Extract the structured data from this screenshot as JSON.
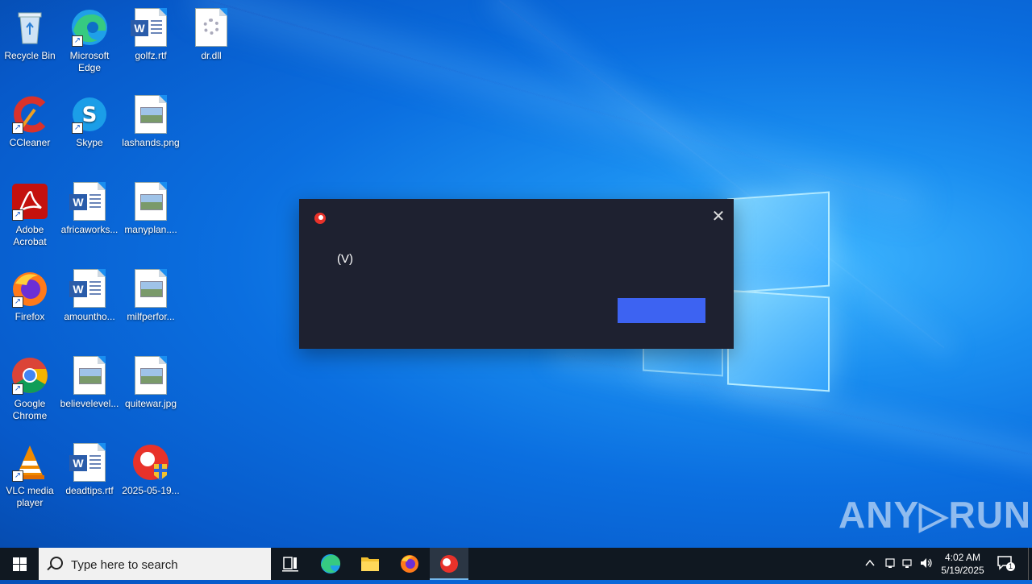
{
  "desktop": {
    "icons": [
      {
        "label": "Recycle Bin"
      },
      {
        "label": "Microsoft Edge"
      },
      {
        "label": "golfz.rtf"
      },
      {
        "label": "dr.dll"
      },
      {
        "label": "CCleaner"
      },
      {
        "label": "Skype"
      },
      {
        "label": "lashands.png"
      },
      {
        "label": "Adobe Acrobat"
      },
      {
        "label": "africaworks..."
      },
      {
        "label": "manyplan...."
      },
      {
        "label": "Firefox"
      },
      {
        "label": "amountho..."
      },
      {
        "label": "milfperfor..."
      },
      {
        "label": "Google Chrome"
      },
      {
        "label": "believelevel..."
      },
      {
        "label": "quitewar.jpg"
      },
      {
        "label": "VLC media player"
      },
      {
        "label": "deadtips.rtf"
      },
      {
        "label": "2025-05-19..."
      }
    ]
  },
  "dialog": {
    "text": "(V)",
    "button_label": ""
  },
  "watermark": "ANY▷RUN",
  "taskbar": {
    "search_placeholder": "Type here to search",
    "clock_time": "4:02 AM",
    "clock_date": "5/19/2025",
    "notification_count": "1"
  }
}
